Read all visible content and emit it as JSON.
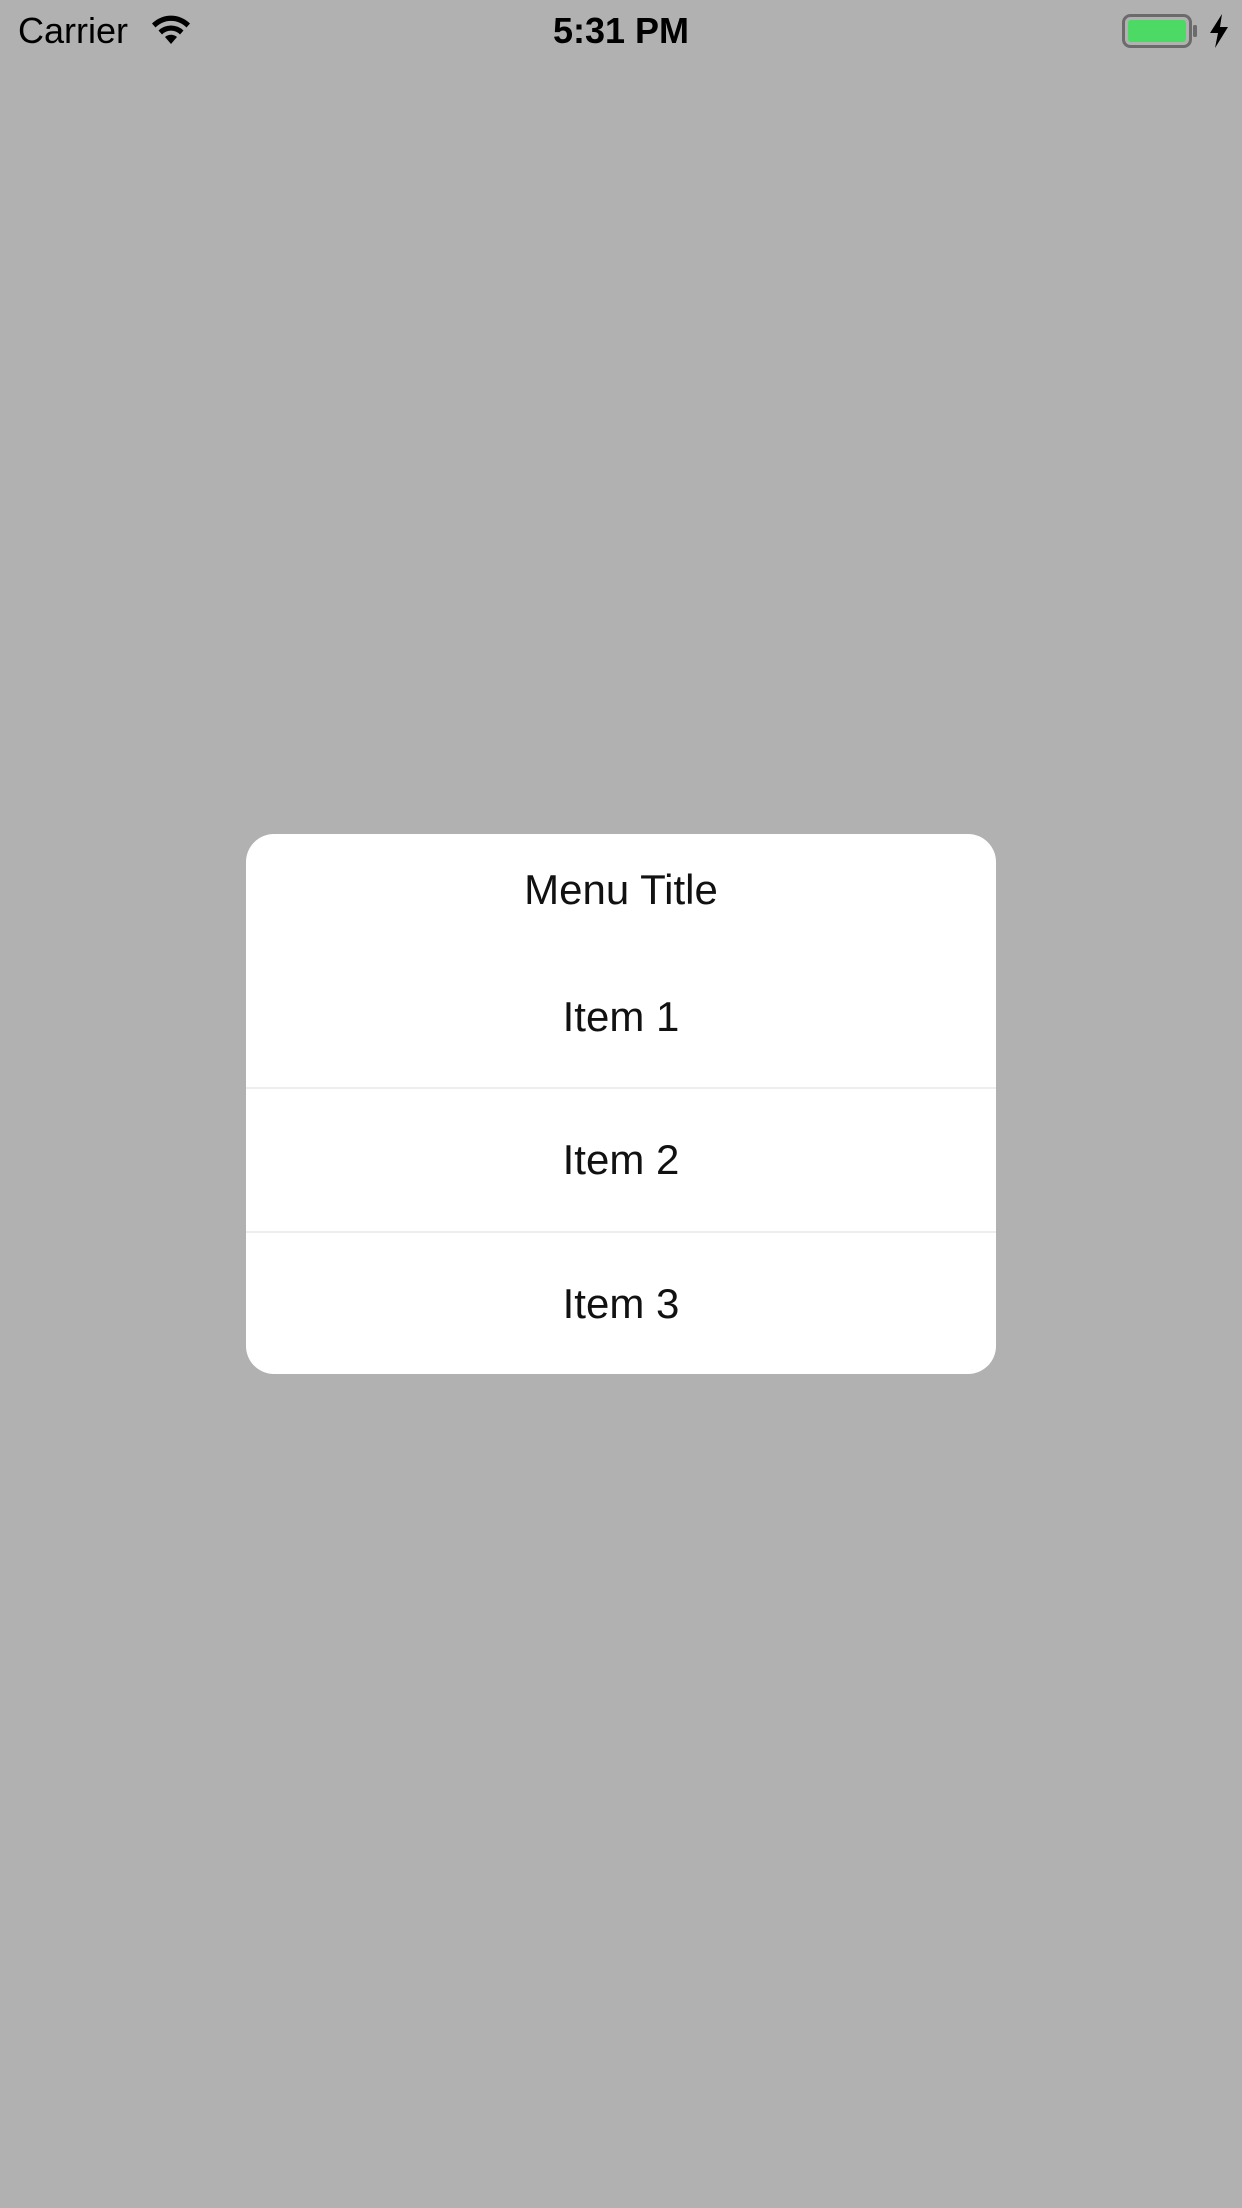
{
  "status_bar": {
    "carrier": "Carrier",
    "time": "5:31 PM",
    "battery_color": "#4cd964",
    "icons": [
      "wifi-icon",
      "battery-icon",
      "charging-icon"
    ]
  },
  "background_color": "#b1b1b1",
  "dialog": {
    "title": "Menu Title",
    "items": [
      {
        "label": "Item 1"
      },
      {
        "label": "Item 2"
      },
      {
        "label": "Item 3"
      }
    ]
  }
}
